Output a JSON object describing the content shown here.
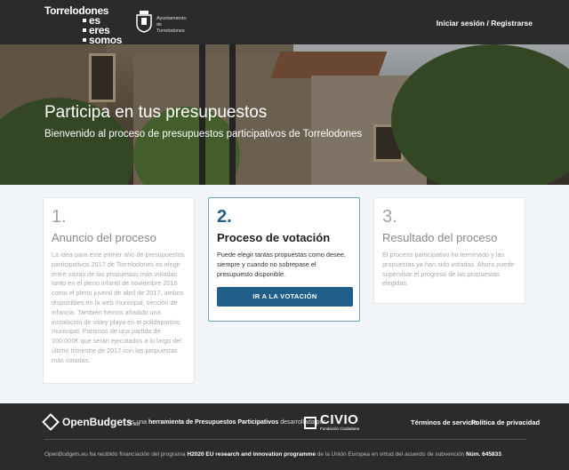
{
  "header": {
    "brand_line1": "Torrelodones",
    "brand_line2": "es",
    "brand_line3": "eres",
    "brand_line4": "somos",
    "ayuntamiento_line1": "Ayuntamiento",
    "ayuntamiento_line2": "de",
    "ayuntamiento_line3": "Torrelodones",
    "login_label": "Iniciar sesión / Registrarse"
  },
  "hero": {
    "title": "Participa en tus presupuestos",
    "subtitle": "Bienvenido al proceso de presupuestos participativos de Torrelodones"
  },
  "steps": [
    {
      "number": "1.",
      "title": "Anuncio del proceso",
      "description": "La idea para este primer año de presupuestos participativos 2017 de Torrelodones es elegir entre varias de las propuestas más votadas tanto en el pleno infantil de noviembre 2016 como el pleno juvenil de abril de 2017, ambos disponibles en la web municipal, sección de infancia. También hemos añadido una instalación de vóley playa en el polideportivo municipal. Partimos de una partida de 100.000€ que serán ejecutados a lo largo del último trimestre de 2017 con las propuestas más votadas."
    },
    {
      "number": "2.",
      "title": "Proceso de votación",
      "description": "Puede elegir tantas propuestas como desee, siempre y cuando no sobrepase el presupuesto disponible.",
      "button_label": "IR A LA VOTACIÓN"
    },
    {
      "number": "3.",
      "title": "Resultado del proceso",
      "description": "El proceso participativo ha terminado y las propuestas ya han sido votadas. Ahora puede supervisar el progreso de las propuestas elegidas."
    }
  ],
  "footer": {
    "openbudgets_name": "OpenBudgets",
    "openbudgets_suffix": ".eu",
    "tagline_pre": "es una ",
    "tagline_bold": "herramienta de Presupuestos Participativos",
    "tagline_post": " desarrollada por",
    "civio_name": "CIVIO",
    "civio_sub": "Fundación Ciudadana",
    "terms_label": "Términos de servicio",
    "privacy_label": "Política de privacidad",
    "funding_pre": "OpenBudgets.eu ha recibido financiación del programa ",
    "funding_bold1": "H2020 EU research and innovation programme",
    "funding_mid": " de la Unión Europea en virtud del acuerdo de subvención ",
    "funding_bold2": "Núm. 645833",
    "funding_end": "."
  },
  "colors": {
    "header_bg": "#2b2b2b",
    "accent_blue": "#1f5f89",
    "steps_bg": "#f3f6f8"
  }
}
